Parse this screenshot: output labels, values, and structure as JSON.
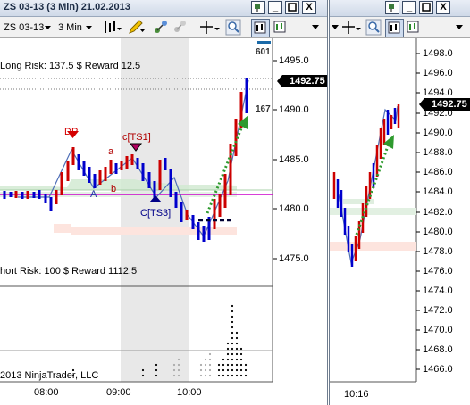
{
  "window1": {
    "title": "ZS 03-13 (3 Min)  21.02.2013",
    "toolbar": {
      "instrument": "ZS 03-13",
      "interval": "3 Min"
    },
    "annotations": {
      "long_risk": "Long Risk: 137.5 $ Reward 12.5",
      "short_risk": "hort Risk: 100 $ Reward 1112.5",
      "dp": "DP",
      "cts1": "c[TS1]",
      "cts3": "C[TS3]",
      "a_upper": "A",
      "a_lower": "a",
      "b_lower": "b",
      "label_601": "601",
      "label_167": "167",
      "copyright": "2013 NinjaTrader, LLC"
    },
    "price_axis": [
      "1495.0",
      "1490.0",
      "1485.0",
      "1480.0",
      "1475.0"
    ],
    "current_price": "1492.75",
    "time_axis": [
      "08:00",
      "09:00",
      "10:00"
    ]
  },
  "window2": {
    "price_axis": [
      "1498.0",
      "1496.0",
      "1494.0",
      "1492.0",
      "1490.0",
      "1488.0",
      "1486.0",
      "1484.0",
      "1482.0",
      "1480.0",
      "1478.0",
      "1476.0",
      "1474.0",
      "1472.0",
      "1470.0",
      "1468.0",
      "1466.0"
    ],
    "current_price": "1492.75",
    "time_axis": [
      "10:16"
    ]
  },
  "colors": {
    "up_bar": "#cc0000",
    "down_bar": "#0000cc",
    "swing_line": "#4f6fb8",
    "magenta_line": "#cc00cc",
    "arrow": "#2e9a2e",
    "session_shade": "#e6e6e6"
  },
  "icons": [
    "bar-style-icon",
    "pencil-icon",
    "crosshair-icon",
    "zoom-icon",
    "strategy-icon",
    "dropdown-icon"
  ]
}
